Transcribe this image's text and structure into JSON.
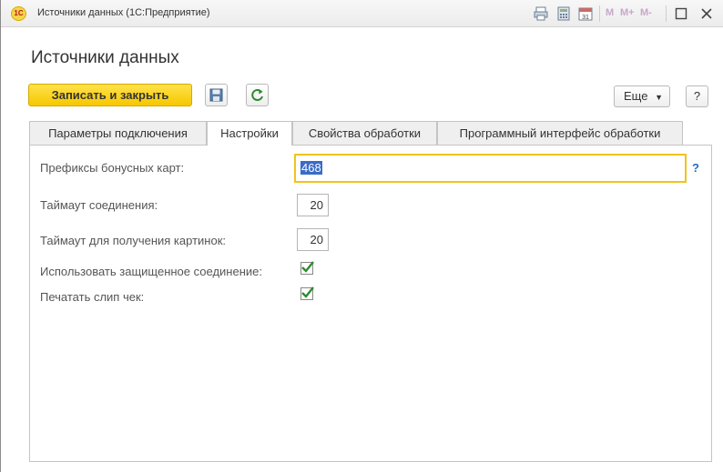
{
  "titlebar": {
    "title": "Источники данных  (1С:Предприятие)",
    "logo_text": "1С",
    "icons": [
      "print-icon",
      "calculator-icon",
      "calendar-icon"
    ],
    "memory_buttons": [
      "M",
      "M+",
      "M-"
    ]
  },
  "page": {
    "title": "Источники данных"
  },
  "toolbar": {
    "save_close_label": "Записать и закрыть",
    "save_icon": "floppy-disk-icon",
    "refresh_icon": "refresh-icon",
    "more_label": "Еще",
    "help_label": "?"
  },
  "tabs": [
    {
      "label": "Параметры подключения",
      "active": false
    },
    {
      "label": "Настройки",
      "active": true
    },
    {
      "label": "Свойства обработки",
      "active": false
    },
    {
      "label": "Программный интерфейс обработки",
      "active": false
    }
  ],
  "form": {
    "bonus_prefix_label": "Префиксы бонусных карт:",
    "bonus_prefix_value": "468",
    "bonus_prefix_help": "?",
    "timeout_label": "Таймаут соединения:",
    "timeout_value": "20",
    "image_timeout_label": "Таймаут для получения картинок:",
    "image_timeout_value": "20",
    "secure_label": "Использовать защищенное соединение:",
    "secure_checked": true,
    "print_slip_label": "Печатать слип чек:",
    "print_slip_checked": true
  },
  "colors": {
    "accent": "#f6c700",
    "check": "#2e8b2e",
    "link": "#1e6fc0",
    "selection": "#3a6cc7"
  }
}
